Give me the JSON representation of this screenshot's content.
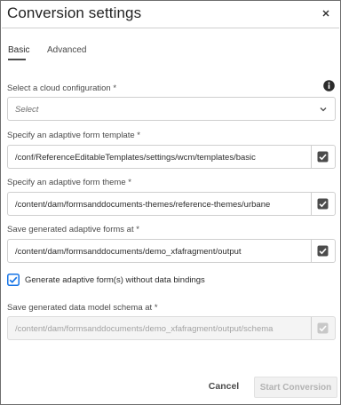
{
  "dialog": {
    "title": "Conversion settings",
    "close_icon": "close-icon"
  },
  "tabs": [
    {
      "label": "Basic",
      "selected": true
    },
    {
      "label": "Advanced",
      "selected": false
    }
  ],
  "cloud_config": {
    "label": "Select a cloud configuration *",
    "placeholder": "Select",
    "info_icon": "info-icon",
    "chevron_icon": "chevron-down-icon"
  },
  "form_template": {
    "label": "Specify an adaptive form template *",
    "value": "/conf/ReferenceEditableTemplates/settings/wcm/templates/basic",
    "checkbox_checked": true
  },
  "form_theme": {
    "label": "Specify an adaptive form theme *",
    "value": "/content/dam/formsanddocuments-themes/reference-themes/urbane",
    "checkbox_checked": true
  },
  "save_forms": {
    "label": "Save generated adaptive forms at *",
    "value": "/content/dam/formsanddocuments/demo_xfafragment/output",
    "checkbox_checked": true
  },
  "no_data_bindings": {
    "label": "Generate adaptive form(s) without data bindings",
    "checked": true
  },
  "save_schema": {
    "label": "Save generated data model schema at *",
    "value": "/content/dam/formsanddocuments/demo_xfafragment/output/schema",
    "disabled": true,
    "checkbox_checked": true
  },
  "footer": {
    "cancel_label": "Cancel",
    "start_label": "Start Conversion"
  },
  "colors": {
    "accent": "#1473e6",
    "checkbox_dark": "#4b4b4b",
    "disabled": "#b3b3b3"
  }
}
